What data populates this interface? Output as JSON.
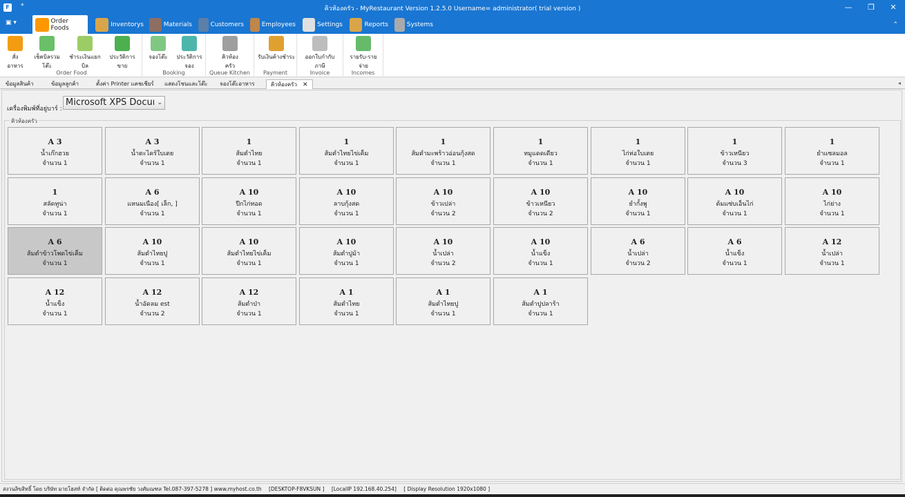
{
  "window": {
    "title": "คิวห้องครัว - MyRestaurant Version 1.2.5.0 Username= administrator( trial version )",
    "app_icon": "F",
    "quick_access": "*",
    "minimize": "—",
    "maximize": "❐",
    "close": "✕"
  },
  "ribbon_tabs": {
    "file_menu": "▣ ▾",
    "collapse": "⌃",
    "tabs": [
      {
        "label": "Order Foods",
        "icon": "order-foods-icon",
        "color": "#ff9800"
      },
      {
        "label": "Inventorys",
        "icon": "inventory-box-icon",
        "color": "#d9a54a"
      },
      {
        "label": "Materials",
        "icon": "materials-icon",
        "color": "#8d6e63"
      },
      {
        "label": "Customers",
        "icon": "customer-person-icon",
        "color": "#5b7fa8"
      },
      {
        "label": "Employees",
        "icon": "employee-person-icon",
        "color": "#c0864a"
      },
      {
        "label": "Settings",
        "icon": "settings-gear-icon",
        "color": "#e0e0e0"
      },
      {
        "label": "Reports",
        "icon": "reports-icon",
        "color": "#d9a54a"
      },
      {
        "label": "Systems",
        "icon": "systems-lock-icon",
        "color": "#aaaaaa"
      }
    ]
  },
  "ribbon": {
    "groups": [
      {
        "label": "Order Food",
        "buttons": [
          {
            "label": "สั่งอาหาร",
            "icon": "order-exit-icon",
            "color": "#f39c12"
          },
          {
            "label": "เช็คบิลรวมโต๊ะ",
            "icon": "merge-bill-icon",
            "color": "#6abf69"
          },
          {
            "label": "ชำระเงินแยกบิล",
            "icon": "split-bill-icon",
            "color": "#9ccc65"
          },
          {
            "label": "ประวัติการขาย",
            "icon": "sales-history-icon",
            "color": "#4caf50"
          }
        ]
      },
      {
        "label": "Booking",
        "buttons": [
          {
            "label": "จองโต๊ะ",
            "icon": "book-table-icon",
            "color": "#81c784"
          },
          {
            "label": "ประวัติการจอง",
            "icon": "booking-history-clock-icon",
            "color": "#4db6ac"
          }
        ]
      },
      {
        "label": "Queue Kitchen",
        "buttons": [
          {
            "label": "คิวห้องครัว",
            "icon": "kitchen-queue-list-icon",
            "color": "#9e9e9e"
          }
        ]
      },
      {
        "label": "Payment",
        "buttons": [
          {
            "label": "รับเงินค้างชำระ",
            "icon": "payment-coins-icon",
            "color": "#e0a030"
          }
        ]
      },
      {
        "label": "Invoice",
        "buttons": [
          {
            "label": "ออกใบกำกับภาษี",
            "icon": "invoice-icon",
            "color": "#bdbdbd"
          }
        ]
      },
      {
        "label": "Incomes",
        "buttons": [
          {
            "label": "รายรับ-รายจ่าย",
            "icon": "income-expense-icon",
            "color": "#66bb6a"
          }
        ]
      }
    ]
  },
  "doc_tabs": {
    "tabs": [
      "ข้อมูลสินค้า",
      "ข้อมูลลูกค้า",
      "ตั้งค่า Printer แคชเชียร์",
      "แสดงโซนและโต๊ะ",
      "จองโต๊ะอาหาร",
      "คิวห้องครัว"
    ],
    "close": "✕",
    "scroll": "◂"
  },
  "printer": {
    "label": "เครื่องพิมพ์ที่อยู่บาร์ :",
    "value": "Microsoft XPS Document Writer",
    "caret": "⌄"
  },
  "kitchen_queue": {
    "title": "คิวห้องครัว",
    "orders": [
      {
        "table": "A 3",
        "item": "น้ำเก๊กฮวย",
        "qty": "จำนวน 1"
      },
      {
        "table": "A 3",
        "item": "น้ำตะไคร้ใบเตย",
        "qty": "จำนวน 1"
      },
      {
        "table": "1",
        "item": "ส้มตำไทย",
        "qty": "จำนวน 1"
      },
      {
        "table": "1",
        "item": "ส้มตำไทยไข่เค็ม",
        "qty": "จำนวน 1"
      },
      {
        "table": "1",
        "item": "ส้มตำมะพร้าวอ่อนกุ้งสด",
        "qty": "จำนวน 1"
      },
      {
        "table": "1",
        "item": "หมูแดดเดียว",
        "qty": "จำนวน 1"
      },
      {
        "table": "1",
        "item": "ไก่ห่อใบเตย",
        "qty": "จำนวน 1"
      },
      {
        "table": "1",
        "item": "ข้าวเหนียว",
        "qty": "จำนวน 3"
      },
      {
        "table": "1",
        "item": "ยำแซลมอล",
        "qty": "จำนวน 1"
      },
      {
        "table": "1",
        "item": "สลัดทูน่า",
        "qty": "จำนวน 1"
      },
      {
        "table": "A 6",
        "item": "แหนมเนือง[ เล็ก, ]",
        "qty": "จำนวน 1"
      },
      {
        "table": "A 10",
        "item": "ปีกไก่ทอด",
        "qty": "จำนวน 1"
      },
      {
        "table": "A 10",
        "item": "ลาบกุ้งสด",
        "qty": "จำนวน 1"
      },
      {
        "table": "A 10",
        "item": "ข้าวเปล่า",
        "qty": "จำนวน 2"
      },
      {
        "table": "A 10",
        "item": "ข้าวเหนียว",
        "qty": "จำนวน 2"
      },
      {
        "table": "A 10",
        "item": "ยำกั้งพู",
        "qty": "จำนวน 1"
      },
      {
        "table": "A 10",
        "item": "ต้มแซ่บเอ็นไก่",
        "qty": "จำนวน 1"
      },
      {
        "table": "A 10",
        "item": "ไก่ย่าง",
        "qty": "จำนวน 1"
      },
      {
        "table": "A 6",
        "item": "ส้มตำข้าวโพดไข่เค็ม",
        "qty": "จำนวน 1"
      },
      {
        "table": "A 10",
        "item": "ส้มตำไทยปู",
        "qty": "จำนวน 1"
      },
      {
        "table": "A 10",
        "item": "ส้มตำไทยไข่เค็ม",
        "qty": "จำนวน 1"
      },
      {
        "table": "A 10",
        "item": "ส้มตำปูม้า",
        "qty": "จำนวน 1"
      },
      {
        "table": "A 10",
        "item": "น้ำเปล่า",
        "qty": "จำนวน 2"
      },
      {
        "table": "A 10",
        "item": "น้ำแข็ง",
        "qty": "จำนวน 1"
      },
      {
        "table": "A 6",
        "item": "น้ำเปล่า",
        "qty": "จำนวน 2"
      },
      {
        "table": "A 6",
        "item": "น้ำแข็ง",
        "qty": "จำนวน 1"
      },
      {
        "table": "A 12",
        "item": "น้ำเปล่า",
        "qty": "จำนวน 1"
      },
      {
        "table": "A 12",
        "item": "น้ำแข็ง",
        "qty": "จำนวน 1"
      },
      {
        "table": "A 12",
        "item": "น้ำอัดลม est",
        "qty": "จำนวน 2"
      },
      {
        "table": "A 12",
        "item": "ส้มตำป่า",
        "qty": "จำนวน 1"
      },
      {
        "table": "A 1",
        "item": "ส้มตำไทย",
        "qty": "จำนวน 1"
      },
      {
        "table": "A 1",
        "item": "ส้มตำไทยปู",
        "qty": "จำนวน 1"
      },
      {
        "table": "A 1",
        "item": "ส้มตำปูปลาร้า",
        "qty": "จำนวน 1"
      }
    ]
  },
  "status_bar": {
    "copyright": "สงวนลิขสิทธิ์ โดย บริษัท มายโฮสท์ จำกัด [ ติดต่อ คุณพรชัย วงศ์มณฑล Tel.087-397-5278 ] www.myhost.co.th",
    "host": "[DESKTOP-F8VKSUN ]",
    "local_ip": "[LocalIP 192.168.40.254]",
    "resolution": "[ Display Resolution 1920x1080 ]"
  }
}
